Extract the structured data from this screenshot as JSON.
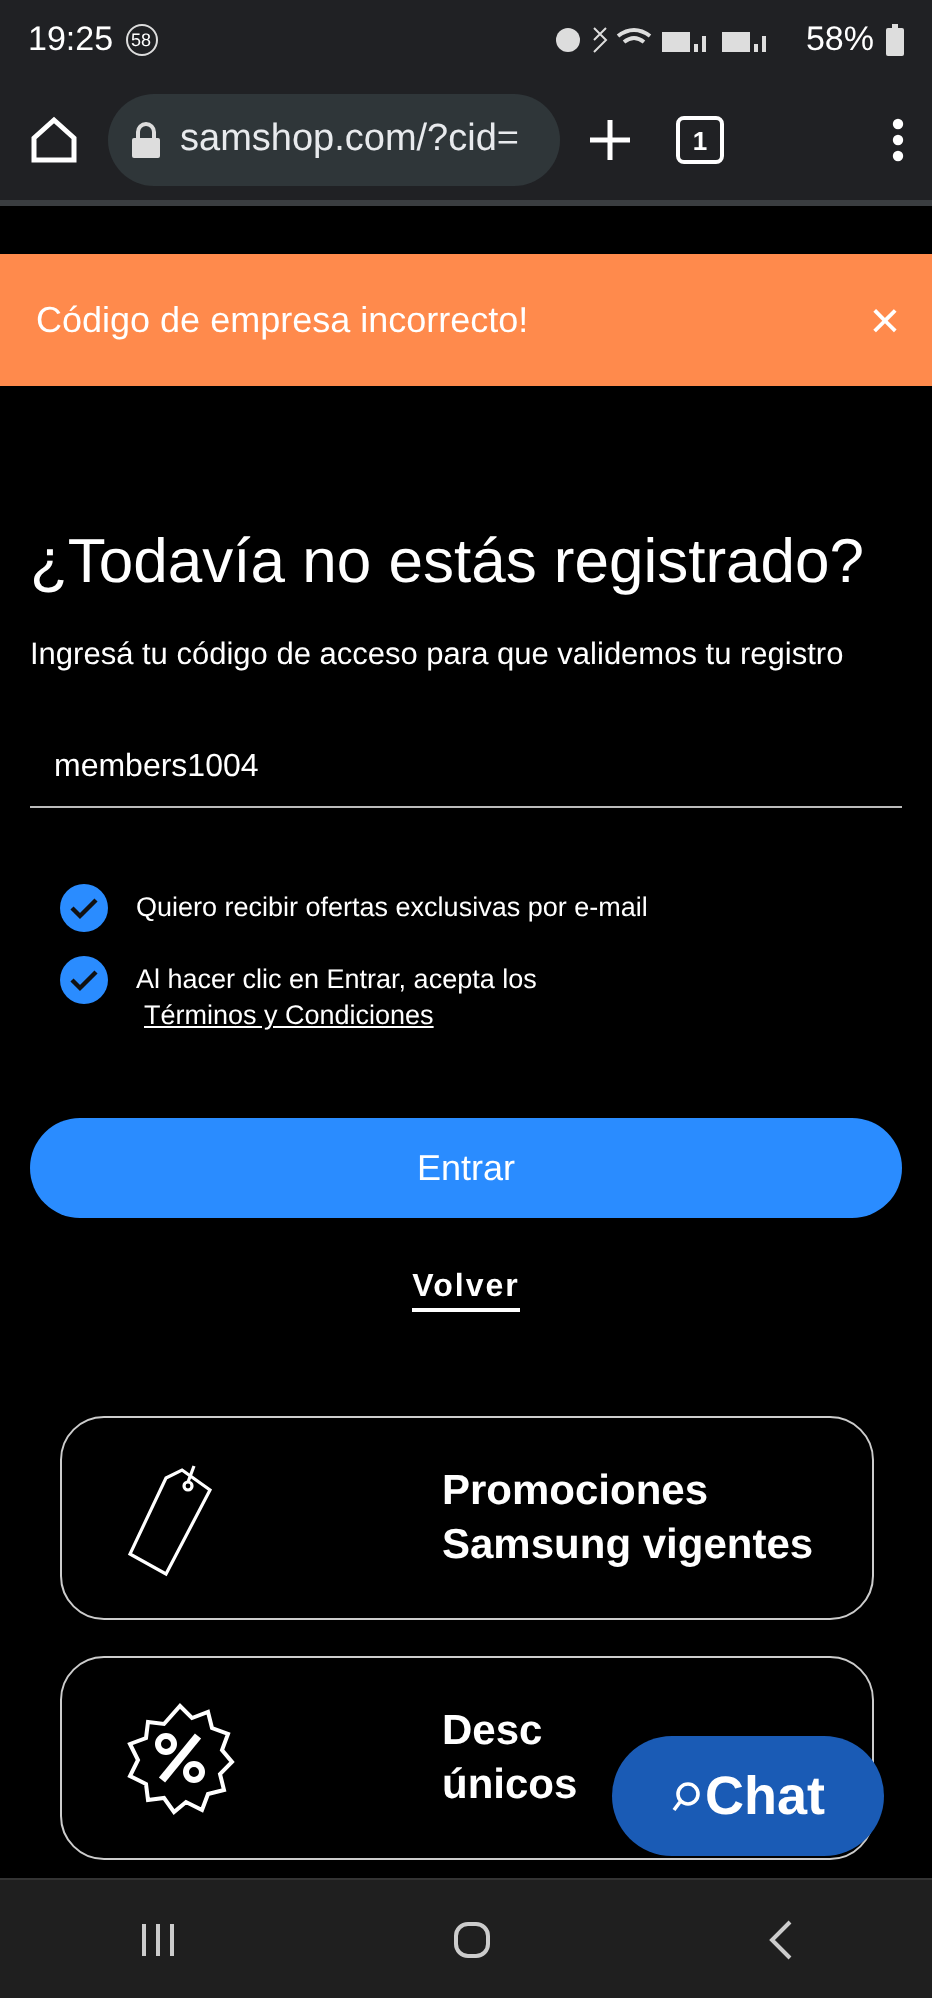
{
  "status_bar": {
    "time": "19:25",
    "notification_count": "58",
    "battery": "58%"
  },
  "browser": {
    "url": "samshop.com/?cid=",
    "tab_count": "1"
  },
  "alert": {
    "message": "Código de empresa incorrecto!",
    "close": "×"
  },
  "heading": "¿Todavía no estás registrado?",
  "subtitle": "Ingresá tu código de acceso para que validemos tu registro",
  "access_code": {
    "value": "members1004"
  },
  "checkboxes": [
    {
      "label": "Quiero recibir ofertas exclusivas por e-mail",
      "checked": true
    },
    {
      "label": "Al hacer clic en Entrar, acepta los",
      "link": "Términos y Condiciones",
      "checked": true
    }
  ],
  "submit_button": "Entrar",
  "back_link": "Volver",
  "cards": [
    {
      "kind": "sale",
      "lines": [
        "Promociones",
        "Samsung vigentes"
      ]
    },
    {
      "kind": "discount",
      "lines": [
        "Desc",
        "únicos"
      ]
    }
  ],
  "chat_button": "Chat"
}
